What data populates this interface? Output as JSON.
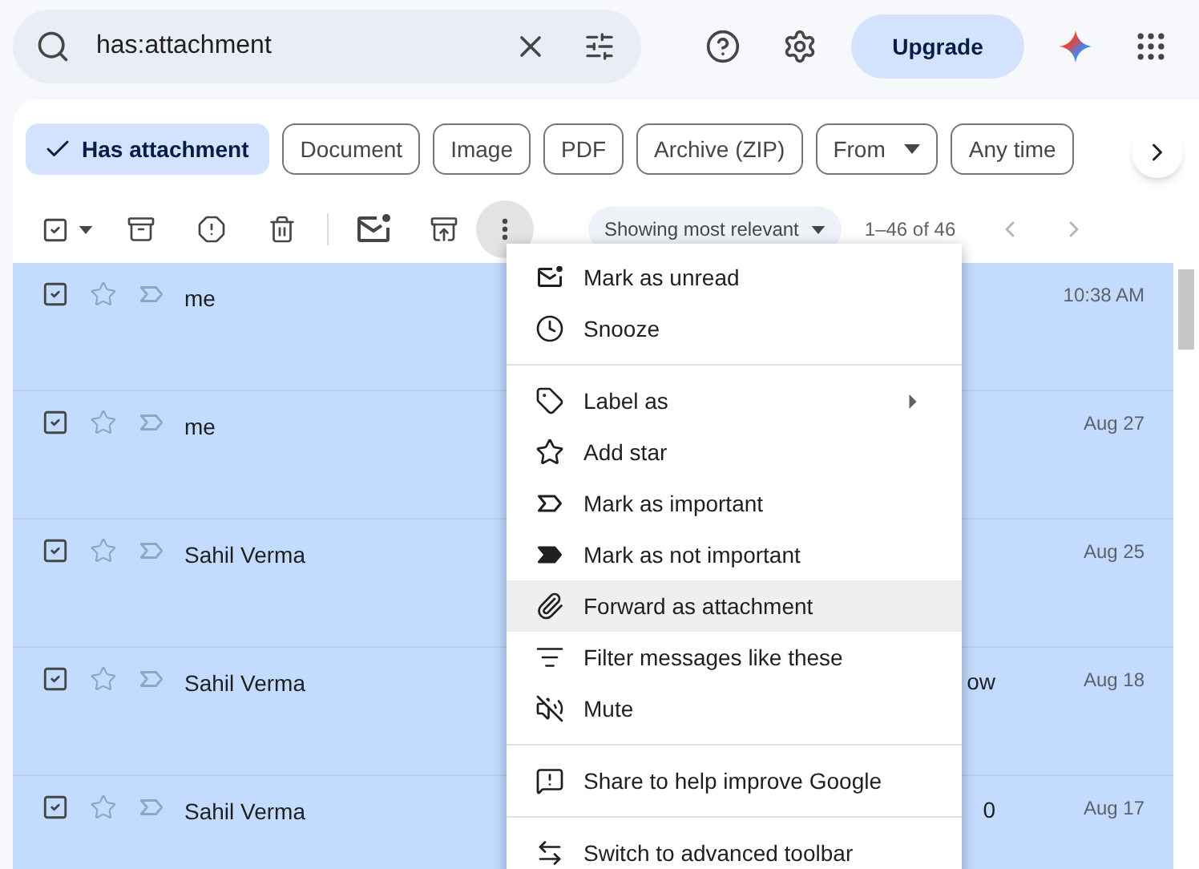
{
  "search": {
    "value": "has:attachment"
  },
  "upgrade": {
    "label": "Upgrade"
  },
  "chips": [
    {
      "label": "Has attachment",
      "selected": true,
      "dropdown": false
    },
    {
      "label": "Document",
      "selected": false,
      "dropdown": false
    },
    {
      "label": "Image",
      "selected": false,
      "dropdown": false
    },
    {
      "label": "PDF",
      "selected": false,
      "dropdown": false
    },
    {
      "label": "Archive (ZIP)",
      "selected": false,
      "dropdown": false
    },
    {
      "label": "From",
      "selected": false,
      "dropdown": true
    },
    {
      "label": "Any time",
      "selected": false,
      "dropdown": false
    }
  ],
  "toolbar": {
    "select_all_checked": true,
    "sort": "Showing most relevant",
    "range": "1–46 of 46"
  },
  "rows": [
    {
      "sender": "me",
      "snippet_end": "",
      "date": "10:38 AM",
      "selected": true
    },
    {
      "sender": "me",
      "snippet_end": "",
      "date": "Aug 27",
      "selected": true
    },
    {
      "sender": "Sahil Verma",
      "snippet_end": "",
      "date": "Aug 25",
      "selected": true
    },
    {
      "sender": "Sahil Verma",
      "snippet_end": "ow",
      "date": "Aug 18",
      "selected": true
    },
    {
      "sender": "Sahil Verma",
      "snippet_end": "0",
      "date": "Aug 17",
      "selected": true
    }
  ],
  "menu": {
    "sections": [
      [
        {
          "label": "Mark as unread",
          "highlighted": false,
          "submenu": false
        },
        {
          "label": "Snooze",
          "highlighted": false,
          "submenu": false
        }
      ],
      [
        {
          "label": "Label as",
          "highlighted": false,
          "submenu": true
        },
        {
          "label": "Add star",
          "highlighted": false,
          "submenu": false
        },
        {
          "label": "Mark as important",
          "highlighted": false,
          "submenu": false
        },
        {
          "label": "Mark as not important",
          "highlighted": false,
          "submenu": false
        },
        {
          "label": "Forward as attachment",
          "highlighted": true,
          "submenu": false
        },
        {
          "label": "Filter messages like these",
          "highlighted": false,
          "submenu": false
        },
        {
          "label": "Mute",
          "highlighted": false,
          "submenu": false
        }
      ],
      [
        {
          "label": "Share to help improve Google",
          "highlighted": false,
          "submenu": false
        }
      ],
      [
        {
          "label": "Switch to advanced toolbar",
          "highlighted": false,
          "submenu": false
        }
      ]
    ]
  }
}
